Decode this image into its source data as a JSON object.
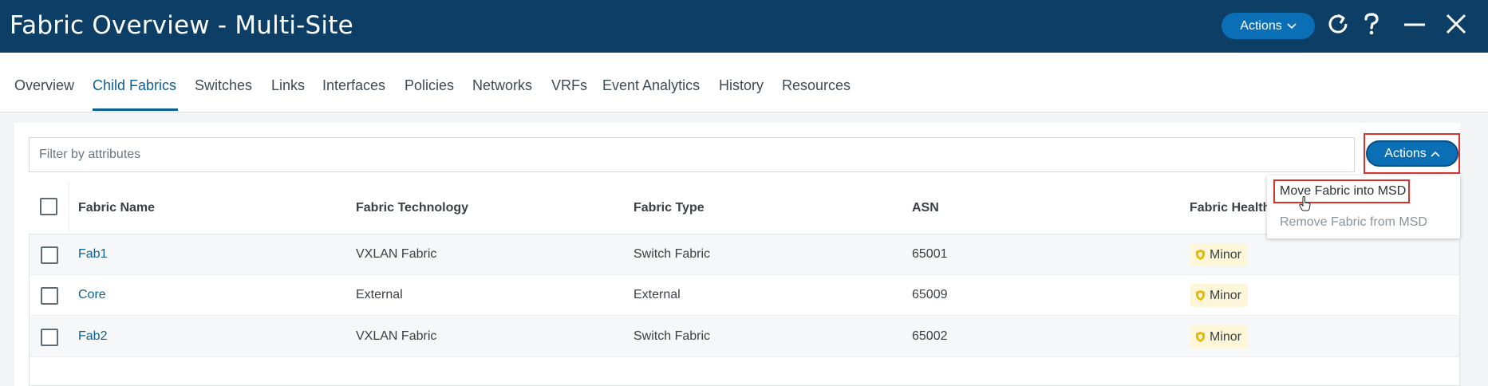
{
  "window": {
    "title": "Fabric Overview - Multi-Site",
    "actions_label": "Actions"
  },
  "tabs": [
    {
      "label": "Overview"
    },
    {
      "label": "Child Fabrics",
      "active": true
    },
    {
      "label": "Switches"
    },
    {
      "label": "Links"
    },
    {
      "label": "Interfaces"
    },
    {
      "label": "Policies"
    },
    {
      "label": "Networks"
    },
    {
      "label": "VRFs"
    },
    {
      "label": "Event Analytics"
    },
    {
      "label": "History"
    },
    {
      "label": "Resources"
    }
  ],
  "filter": {
    "placeholder": "Filter by attributes"
  },
  "toolbar": {
    "actions_label": "Actions"
  },
  "actions_menu": {
    "items": [
      {
        "label": "Move Fabric into MSD",
        "enabled": true
      },
      {
        "label": "Remove Fabric from MSD",
        "enabled": false
      }
    ]
  },
  "table": {
    "columns": [
      "Fabric Name",
      "Fabric Technology",
      "Fabric Type",
      "ASN",
      "Fabric Health"
    ],
    "rows": [
      {
        "name": "Fab1",
        "technology": "VXLAN Fabric",
        "type": "Switch Fabric",
        "asn": "65001",
        "health": "Minor"
      },
      {
        "name": "Core",
        "technology": "External",
        "type": "External",
        "asn": "65009",
        "health": "Minor"
      },
      {
        "name": "Fab2",
        "technology": "VXLAN Fabric",
        "type": "Switch Fabric",
        "asn": "65002",
        "health": "Minor"
      }
    ]
  },
  "colors": {
    "titlebar": "#0d3f66",
    "accent": "#0a6fb5",
    "link": "#0c5f95",
    "highlight": "#d8322b",
    "health_minor_bg": "#fdf6d8",
    "health_minor_icon": "#e6b800"
  },
  "icons": [
    "refresh-icon",
    "help-icon",
    "minimize-icon",
    "close-icon",
    "chevron-down-icon",
    "chevron-up-icon",
    "shield-icon",
    "hand-cursor-icon"
  ]
}
